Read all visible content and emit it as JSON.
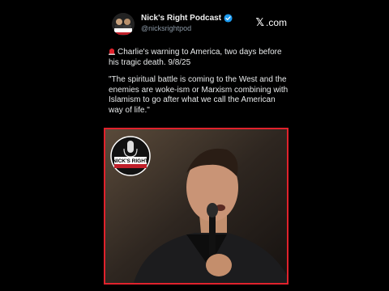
{
  "header": {
    "display_name": "Nick's Right Podcast",
    "handle": "@nicksrightpod",
    "platform": ".com",
    "platform_mark": "𝕏"
  },
  "post": {
    "line1": "Charlie's warning to America, two days before his tragic death. 9/8/25",
    "quote": "\"The spiritual battle is coming to the West and the enemies are woke-ism or Marxism combining with Islamism to go after what we call the American way of life.\""
  },
  "media": {
    "logo_text": "NICK'S RIGHT",
    "border_color": "#e0222c"
  },
  "colors": {
    "background": "#000000",
    "verified": "#1d9bf0",
    "handle": "#8b98a5"
  }
}
